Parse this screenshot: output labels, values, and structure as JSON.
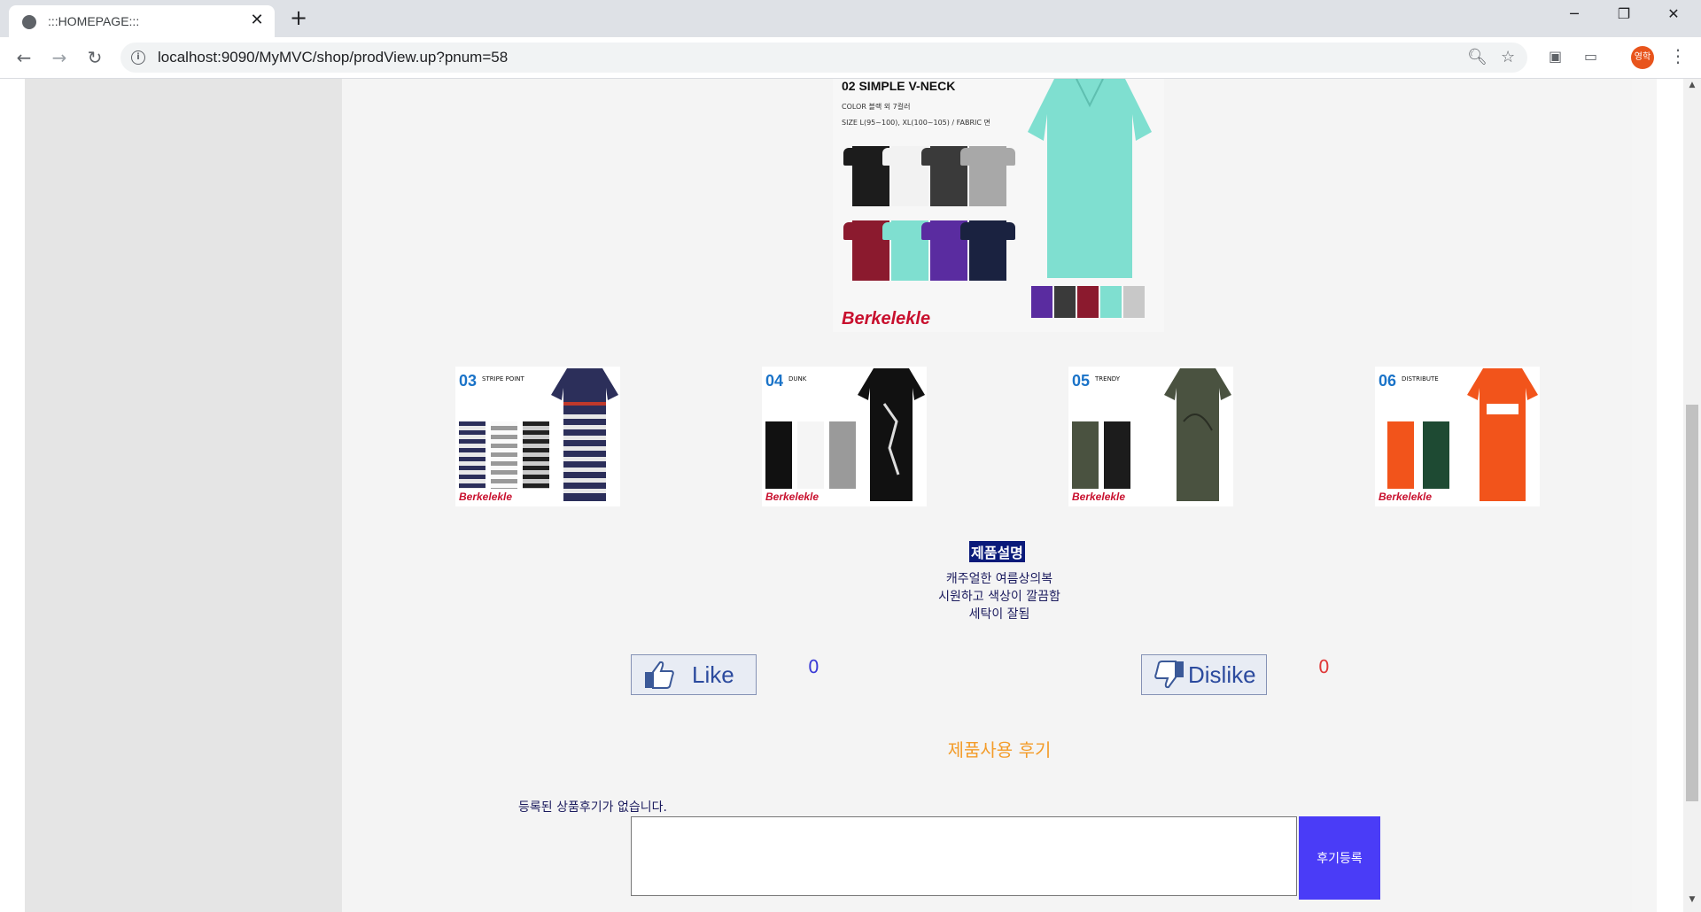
{
  "browser": {
    "tab_title": ":::HOMEPAGE:::",
    "tab_close": "✕",
    "new_tab": "+",
    "url": "localhost:9090/MyMVC/shop/prodView.up?pnum=58",
    "profile_initials": "영학",
    "window_controls": {
      "minimize": "─",
      "restore": "❐",
      "close": "✕"
    }
  },
  "product": {
    "main_image": {
      "number_title": "02 SIMPLE V-NECK",
      "color_line": "COLOR 블랙 외 7컬러",
      "size_line": "SIZE L(95~100), XL(100~105) / FABRIC 면",
      "brand": "Berkelekle"
    },
    "thumbnails": [
      {
        "number": "03",
        "name": "STRIPE POINT",
        "brand": "Berkelekle"
      },
      {
        "number": "04",
        "name": "DUNK",
        "brand": "Berkelekle"
      },
      {
        "number": "05",
        "name": "TRENDY",
        "brand": "Berkelekle"
      },
      {
        "number": "06",
        "name": "DISTRIBUTE",
        "brand": "Berkelekle"
      }
    ],
    "description_heading": "제품설명",
    "description_lines": [
      "캐주얼한 여름상의복",
      "시원하고 색상이 깔끔함",
      "세탁이 잘됨"
    ],
    "like": {
      "label": "Like",
      "count": "0",
      "count_color": "#3b3bd6"
    },
    "dislike": {
      "label": "Dislike",
      "count": "0",
      "count_color": "#e03a3a"
    }
  },
  "reviews": {
    "heading": "제품사용 후기",
    "empty_message": "등록된 상품후기가 없습니다.",
    "input_value": "",
    "submit_label": "후기등록"
  },
  "colors": {
    "accent_button": "#4a3cf7",
    "review_heading": "#f39c2a",
    "description_heading_bg": "#0a1a7a"
  }
}
